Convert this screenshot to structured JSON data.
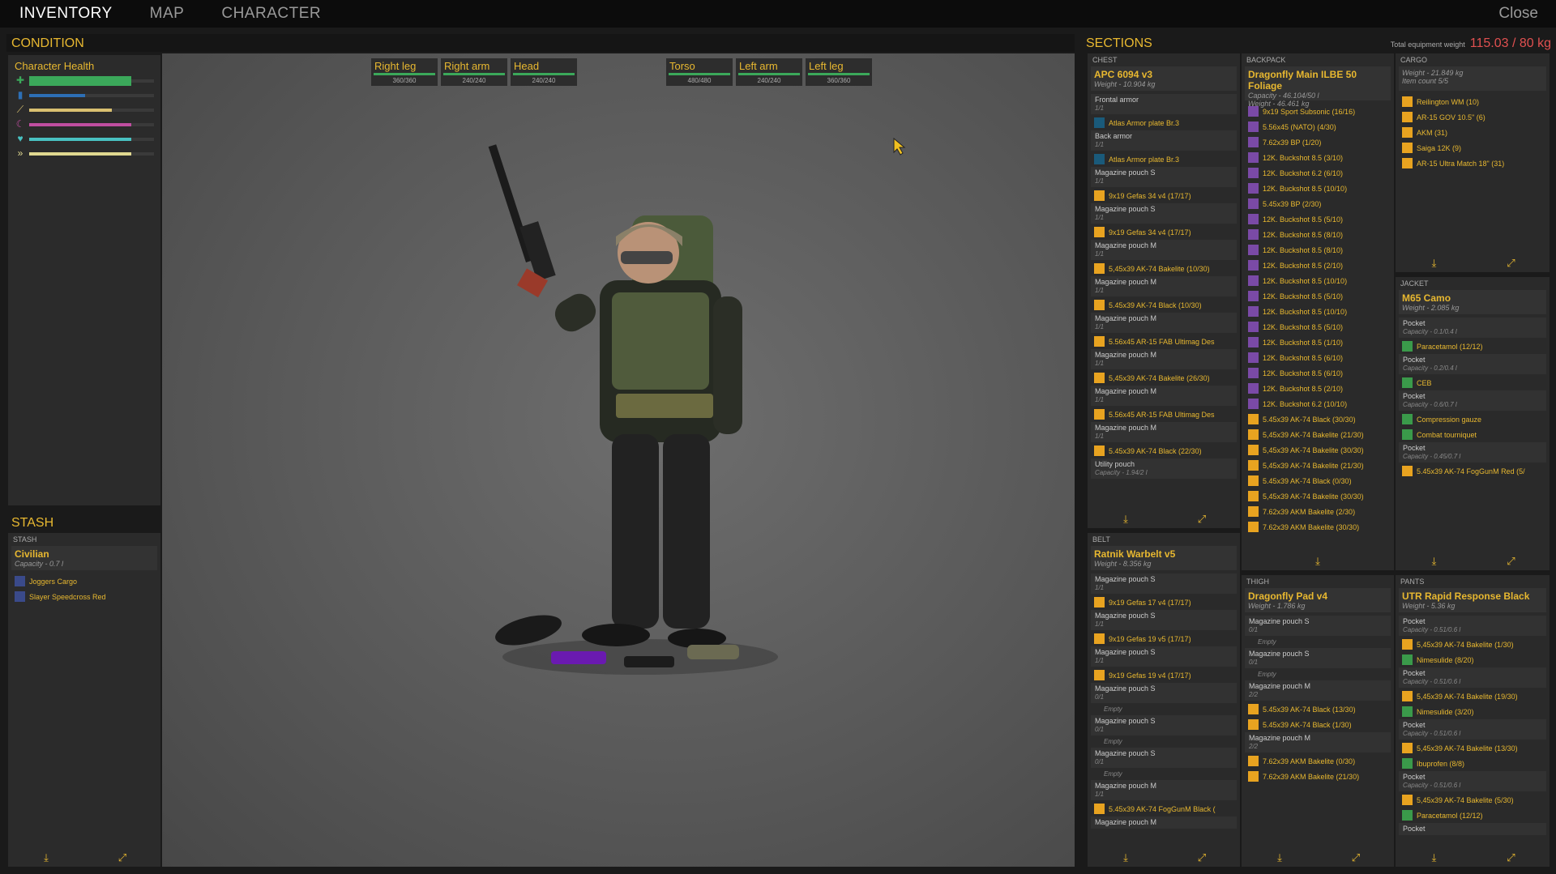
{
  "topbar": {
    "tabs": [
      "INVENTORY",
      "MAP",
      "CHARACTER"
    ],
    "close": "Close"
  },
  "condition": {
    "header": "CONDITION",
    "health_title": "Character Health",
    "bars": [
      {
        "icon": "plus-icon",
        "color": "#3ba85a",
        "level": 0.82
      },
      {
        "icon": "drop-icon",
        "color": "#2d6fb5",
        "level": 0.45
      },
      {
        "icon": "food-icon",
        "color": "#d9c070",
        "level": 0.66
      },
      {
        "icon": "moon-icon",
        "color": "#c04ea0",
        "level": 0.82
      },
      {
        "icon": "heart-icon",
        "color": "#49c2c2",
        "level": 0.82
      },
      {
        "icon": "run-icon",
        "color": "#e0d890",
        "level": 0.82
      }
    ]
  },
  "body_parts": [
    {
      "name": "Right leg",
      "value": "360/360"
    },
    {
      "name": "Right arm",
      "value": "240/240"
    },
    {
      "name": "Head",
      "value": "240/240"
    },
    {
      "name": "Torso",
      "value": "480/480"
    },
    {
      "name": "Left arm",
      "value": "240/240"
    },
    {
      "name": "Left leg",
      "value": "360/360"
    }
  ],
  "stash": {
    "header": "STASH",
    "category": "STASH",
    "name": "Civilian",
    "capacity": "Capacity - 0.7 l",
    "items": [
      "Joggers Cargo",
      "Slayer Speedcross Red"
    ]
  },
  "sections": {
    "header": "SECTIONS",
    "weight_label": "Total equipment weight",
    "weight_value": "115.03 / 80 kg",
    "chest": {
      "category": "CHEST",
      "name": "APC 6094 v3",
      "weight": "Weight - 10.904 kg",
      "slots": [
        {
          "name": "Frontal armor",
          "count": "1/1",
          "item": "Atlas Armor plate Br.3",
          "icon": "teal"
        },
        {
          "name": "Back armor",
          "count": "1/1",
          "item": "Atlas Armor plate Br.3",
          "icon": "teal"
        },
        {
          "name": "Magazine pouch S",
          "count": "1/1",
          "item": "9x19 Gefas 34 v4 (17/17)",
          "icon": "orange"
        },
        {
          "name": "Magazine pouch S",
          "count": "1/1",
          "item": "9x19 Gefas 34 v4 (17/17)",
          "icon": "orange"
        },
        {
          "name": "Magazine pouch M",
          "count": "1/1",
          "item": "5,45x39 AK-74 Bakelite (10/30)",
          "icon": "orange"
        },
        {
          "name": "Magazine pouch M",
          "count": "1/1",
          "item": "5.45x39 AK-74 Black (10/30)",
          "icon": "orange"
        },
        {
          "name": "Magazine pouch M",
          "count": "1/1",
          "item": "5.56x45 AR-15 FAB Ultimag Des",
          "icon": "orange"
        },
        {
          "name": "Magazine pouch M",
          "count": "1/1",
          "item": "5,45x39 AK-74 Bakelite (26/30)",
          "icon": "orange"
        },
        {
          "name": "Magazine pouch M",
          "count": "1/1",
          "item": "5.56x45 AR-15 FAB Ultimag Des",
          "icon": "orange"
        },
        {
          "name": "Magazine pouch M",
          "count": "1/1",
          "item": "5.45x39 AK-74 Black (22/30)",
          "icon": "orange"
        },
        {
          "name": "Utility pouch",
          "count": "Capacity - 1.94/2 l",
          "item": "",
          "icon": ""
        }
      ]
    },
    "backpack": {
      "category": "BACKPACK",
      "name": "Dragonfly Main ILBE 50 Foliage",
      "capacity": "Capacity - 46.104/50 l",
      "weight": "Weight - 46.461 kg",
      "items": [
        {
          "t": "9x19 Sport Subsonic (16/16)",
          "c": "purple"
        },
        {
          "t": "5.56x45 (NATO) (4/30)",
          "c": "purple"
        },
        {
          "t": "7.62x39 BP (1/20)",
          "c": "purple"
        },
        {
          "t": "12K. Buckshot 8.5 (3/10)",
          "c": "purple"
        },
        {
          "t": "12K. Buckshot 6.2 (6/10)",
          "c": "purple"
        },
        {
          "t": "12K. Buckshot 8.5 (10/10)",
          "c": "purple"
        },
        {
          "t": "5.45x39 BP (2/30)",
          "c": "purple"
        },
        {
          "t": "12K. Buckshot 8.5 (5/10)",
          "c": "purple"
        },
        {
          "t": "12K. Buckshot 8.5 (8/10)",
          "c": "purple"
        },
        {
          "t": "12K. Buckshot 8.5 (8/10)",
          "c": "purple"
        },
        {
          "t": "12K. Buckshot 8.5 (2/10)",
          "c": "purple"
        },
        {
          "t": "12K. Buckshot 8.5 (10/10)",
          "c": "purple"
        },
        {
          "t": "12K. Buckshot 8.5 (5/10)",
          "c": "purple"
        },
        {
          "t": "12K. Buckshot 8.5 (10/10)",
          "c": "purple"
        },
        {
          "t": "12K. Buckshot 8.5 (5/10)",
          "c": "purple"
        },
        {
          "t": "12K. Buckshot 8.5 (1/10)",
          "c": "purple"
        },
        {
          "t": "12K. Buckshot 8.5 (6/10)",
          "c": "purple"
        },
        {
          "t": "12K. Buckshot 8.5 (6/10)",
          "c": "purple"
        },
        {
          "t": "12K. Buckshot 8.5 (2/10)",
          "c": "purple"
        },
        {
          "t": "12K. Buckshot 6.2 (10/10)",
          "c": "purple"
        },
        {
          "t": "5.45x39 AK-74 Black (30/30)",
          "c": "orange"
        },
        {
          "t": "5,45x39 AK-74 Bakelite (21/30)",
          "c": "orange"
        },
        {
          "t": "5,45x39 AK-74 Bakelite (30/30)",
          "c": "orange"
        },
        {
          "t": "5,45x39 AK-74 Bakelite (21/30)",
          "c": "orange"
        },
        {
          "t": "5.45x39 AK-74 Black (0/30)",
          "c": "orange"
        },
        {
          "t": "5,45x39 AK-74 Bakelite (30/30)",
          "c": "orange"
        },
        {
          "t": "7.62x39 AKM Bakelite (2/30)",
          "c": "orange"
        },
        {
          "t": "7.62x39 AKM Bakelite (30/30)",
          "c": "orange"
        }
      ]
    },
    "cargo": {
      "category": "CARGO",
      "weight": "Weight - 21.849 kg",
      "count": "Item count 5/5",
      "items": [
        "Reilington WM (10)",
        "AR-15 GOV 10.5\" (6)",
        "AKM (31)",
        "Saiga 12K (9)",
        "AR-15 Ultra Match 18\" (31)"
      ]
    },
    "jacket": {
      "category": "JACKET",
      "name": "M65 Camo",
      "weight": "Weight - 2.085 kg",
      "slots": [
        {
          "name": "Pocket",
          "cap": "Capacity - 0.1/0.4 l",
          "items": [
            {
              "t": "Paracetamol (12/12)",
              "c": "green"
            }
          ]
        },
        {
          "name": "Pocket",
          "cap": "Capacity - 0.2/0.4 l",
          "items": [
            {
              "t": "CEB",
              "c": "green"
            }
          ]
        },
        {
          "name": "Pocket",
          "cap": "Capacity - 0.6/0.7 l",
          "items": [
            {
              "t": "Compression gauze",
              "c": "green"
            },
            {
              "t": "Combat tourniquet",
              "c": "green"
            }
          ]
        },
        {
          "name": "Pocket",
          "cap": "Capacity - 0.45/0.7 l",
          "items": [
            {
              "t": "5.45x39 AK-74 FogGunM Red (5/",
              "c": "orange"
            }
          ]
        }
      ]
    },
    "belt": {
      "category": "BELT",
      "name": "Ratnik Warbelt v5",
      "weight": "Weight - 8.356 kg",
      "slots": [
        {
          "name": "Magazine pouch S",
          "count": "1/1",
          "item": "9x19 Gefas 17 v4 (17/17)"
        },
        {
          "name": "Magazine pouch S",
          "count": "1/1",
          "item": "9x19 Gefas 19 v5 (17/17)"
        },
        {
          "name": "Magazine pouch S",
          "count": "1/1",
          "item": "9x19 Gefas 19 v4 (17/17)"
        },
        {
          "name": "Magazine pouch S",
          "count": "0/1",
          "item": ""
        },
        {
          "name": "Magazine pouch S",
          "count": "0/1",
          "item": ""
        },
        {
          "name": "Magazine pouch S",
          "count": "0/1",
          "item": ""
        },
        {
          "name": "Magazine pouch M",
          "count": "1/1",
          "item": "5.45x39 AK-74 FogGunM Black ("
        },
        {
          "name": "Magazine pouch M",
          "count": "",
          "item": ""
        }
      ],
      "empty_label": "Empty"
    },
    "thigh": {
      "category": "THIGH",
      "name": "Dragonfly Pad v4",
      "weight": "Weight - 1.786 kg",
      "slots": [
        {
          "name": "Magazine pouch S",
          "count": "0/1",
          "items": []
        },
        {
          "name": "Magazine pouch S",
          "count": "0/1",
          "items": []
        },
        {
          "name": "Magazine pouch M",
          "count": "2/2",
          "items": [
            "5.45x39 AK-74 Black (13/30)",
            "5.45x39 AK-74 Black (1/30)"
          ]
        },
        {
          "name": "Magazine pouch M",
          "count": "2/2",
          "items": [
            "7.62x39 AKM Bakelite (0/30)",
            "7.62x39 AKM Bakelite (21/30)"
          ]
        }
      ],
      "empty_label": "Empty"
    },
    "pants": {
      "category": "PANTS",
      "name": "UTR Rapid Response Black",
      "weight": "Weight - 5.36 kg",
      "slots": [
        {
          "name": "Pocket",
          "cap": "Capacity - 0.51/0.6 l",
          "items": [
            {
              "t": "5,45x39 AK-74 Bakelite (1/30)",
              "c": "orange"
            },
            {
              "t": "Nimesulide (8/20)",
              "c": "green"
            }
          ]
        },
        {
          "name": "Pocket",
          "cap": "Capacity - 0.51/0.6 l",
          "items": [
            {
              "t": "5,45x39 AK-74 Bakelite (19/30)",
              "c": "orange"
            },
            {
              "t": "Nimesulide (3/20)",
              "c": "green"
            }
          ]
        },
        {
          "name": "Pocket",
          "cap": "Capacity - 0.51/0.6 l",
          "items": [
            {
              "t": "5,45x39 AK-74 Bakelite (13/30)",
              "c": "orange"
            },
            {
              "t": "Ibuprofen (8/8)",
              "c": "green"
            }
          ]
        },
        {
          "name": "Pocket",
          "cap": "Capacity - 0.51/0.6 l",
          "items": [
            {
              "t": "5,45x39 AK-74 Bakelite (5/30)",
              "c": "orange"
            },
            {
              "t": "Paracetamol (12/12)",
              "c": "green"
            }
          ]
        },
        {
          "name": "Pocket",
          "cap": "",
          "items": []
        }
      ]
    }
  }
}
